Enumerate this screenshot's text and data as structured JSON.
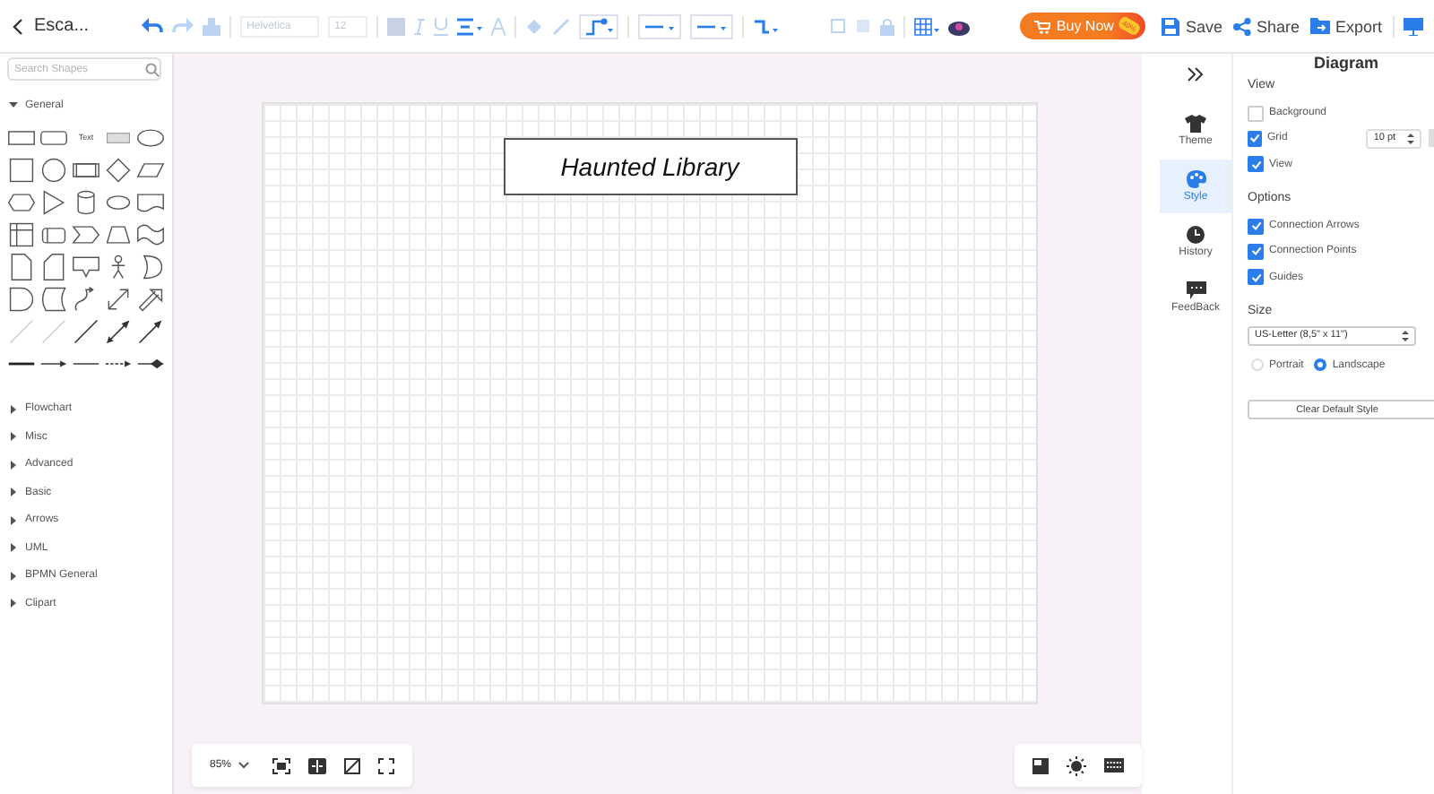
{
  "toolbar": {
    "title": "Esca...",
    "font": "Helvetica",
    "font_size": "12"
  },
  "buy_button": {
    "label": "Buy Now",
    "badge": "40%"
  },
  "actions": [
    {
      "kind": "save",
      "label": "Save"
    },
    {
      "kind": "share",
      "label": "Share"
    },
    {
      "kind": "export",
      "label": "Export"
    }
  ],
  "sidebar": {
    "search": {
      "placeholder": "Search Shapes"
    },
    "text_shape": "Text",
    "categories": [
      {
        "label": "General",
        "expanded": true
      },
      {
        "label": "Flowchart",
        "expanded": false
      },
      {
        "label": "Misc",
        "expanded": false
      },
      {
        "label": "Advanced",
        "expanded": false
      },
      {
        "label": "Basic",
        "expanded": false
      },
      {
        "label": "Arrows",
        "expanded": false
      },
      {
        "label": "UML",
        "expanded": false
      },
      {
        "label": "BPMN General",
        "expanded": false
      },
      {
        "label": "Clipart",
        "expanded": false
      }
    ]
  },
  "canvas": {
    "shape_label": "Haunted Library"
  },
  "zoom": {
    "value": "85%"
  },
  "rail_tabs": [
    {
      "kind": "theme",
      "label": "Theme",
      "selected": false
    },
    {
      "kind": "style",
      "label": "Style",
      "selected": true
    },
    {
      "kind": "history",
      "label": "History",
      "selected": false
    },
    {
      "kind": "feedback",
      "label": "FeedBack",
      "selected": false
    }
  ],
  "panel": {
    "title": "Diagram",
    "view_heading": "View",
    "view_options": [
      {
        "label": "Background",
        "checked": false
      },
      {
        "label": "Grid",
        "checked": true,
        "value": "10 pt"
      },
      {
        "label": "View",
        "checked": true
      }
    ],
    "options_heading": "Options",
    "options": [
      {
        "label": "Connection Arrows",
        "checked": true
      },
      {
        "label": "Connection Points",
        "checked": true
      },
      {
        "label": "Guides",
        "checked": true
      }
    ],
    "size_heading": "Size",
    "paper": "US-Letter (8,5\" x 11\")",
    "orientation": [
      {
        "label": "Portrait",
        "selected": false
      },
      {
        "label": "Landscape",
        "selected": true
      }
    ],
    "clear_button": "Clear Default Style"
  }
}
